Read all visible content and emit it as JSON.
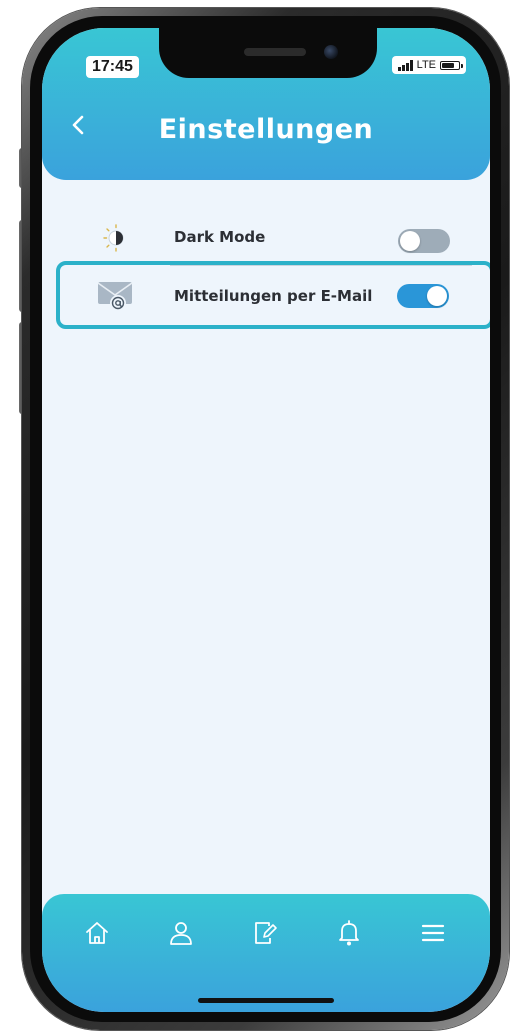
{
  "status_bar": {
    "time": "17:45",
    "network": "LTE",
    "battery_level": 0.75
  },
  "header": {
    "back_icon": "chevron-left-icon",
    "title": "Einstellungen"
  },
  "settings": [
    {
      "label": "Dark Mode",
      "icon": "half-sun-icon",
      "enabled": false
    },
    {
      "label": "Mitteilungen per E-Mail",
      "icon": "envelope-at-icon",
      "enabled": true,
      "highlighted": true
    }
  ],
  "tabbar": {
    "items": [
      {
        "name": "home",
        "icon": "home-icon"
      },
      {
        "name": "profile",
        "icon": "user-icon"
      },
      {
        "name": "edit",
        "icon": "edit-document-icon"
      },
      {
        "name": "notifications",
        "icon": "bell-icon"
      },
      {
        "name": "menu",
        "icon": "menu-icon"
      }
    ]
  },
  "colors": {
    "header_gradient_start": "#39c6d4",
    "header_gradient_end": "#3aa2dc",
    "screen_background": "#eef5fc",
    "toggle_on": "#2a96d8",
    "toggle_off": "#9eacb8",
    "highlight_border": "#2bb1c9"
  }
}
